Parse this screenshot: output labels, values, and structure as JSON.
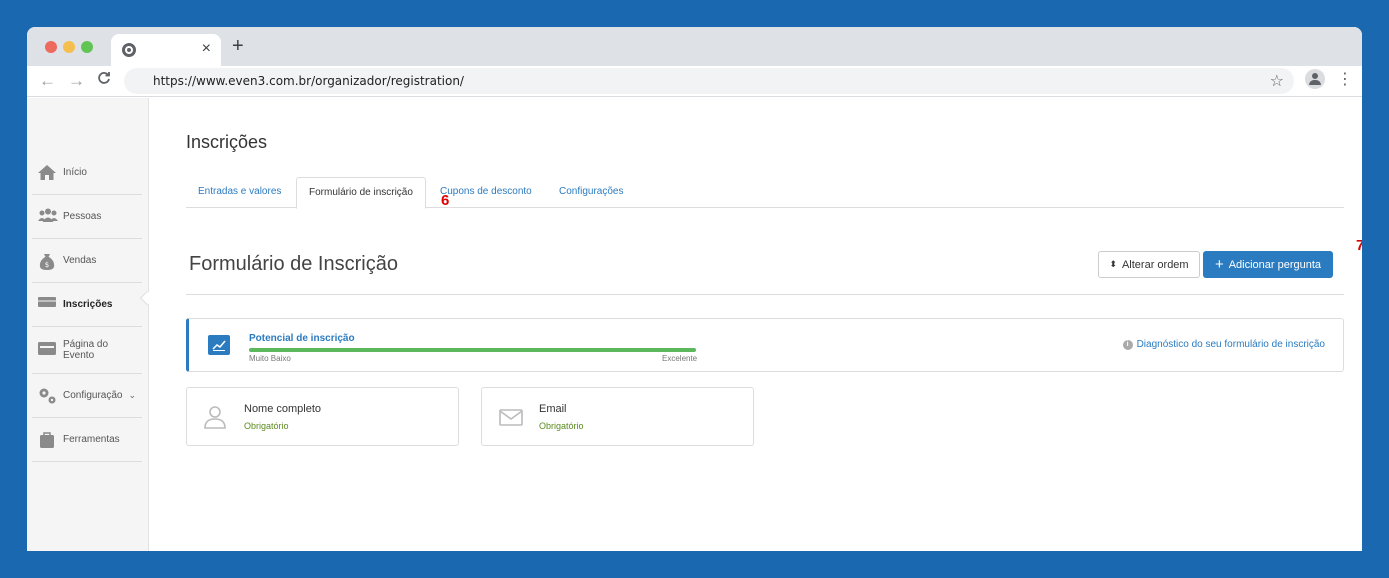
{
  "browser": {
    "tab_close": "×",
    "new_tab": "+",
    "url": "https://www.even3.com.br/organizador/registration/",
    "back": "←",
    "forward": "→",
    "reload": "C",
    "bookmark": "☆",
    "menu": "⋮"
  },
  "sidebar": {
    "items": [
      {
        "label": "Início",
        "icon": "home-icon"
      },
      {
        "label": "Pessoas",
        "icon": "people-icon"
      },
      {
        "label": "Vendas",
        "icon": "money-bag-icon"
      },
      {
        "label": "Inscrições",
        "icon": "ticket-icon",
        "active": true
      },
      {
        "label": "Página do Evento",
        "icon": "browser-window-icon"
      },
      {
        "label": "Configuração",
        "icon": "gears-icon",
        "chevron": "⌄"
      },
      {
        "label": "Ferramentas",
        "icon": "toolbox-icon"
      }
    ]
  },
  "main": {
    "title": "Inscrições",
    "tabs": [
      {
        "label": "Entradas e valores"
      },
      {
        "label": "Formulário de inscrição",
        "active": true
      },
      {
        "label": "Cupons de desconto"
      },
      {
        "label": "Configurações"
      }
    ],
    "section_title": "Formulário de Inscrição",
    "order_button": "Alterar ordem",
    "add_button": "Adicionar pergunta",
    "add_button_plus": "+",
    "order_icon": "⬍",
    "potential": {
      "title": "Potencial de inscrição",
      "low_label": "Muito Baixo",
      "high_label": "Excelente",
      "level": 1.0,
      "diagnostic_link": "Diagnóstico do seu formulário de inscrição",
      "info_glyph": "i"
    },
    "fields": [
      {
        "name": "Nome completo",
        "required": "Obrigatório",
        "icon": "user-icon"
      },
      {
        "name": "Email",
        "required": "Obrigatório",
        "icon": "envelope-icon"
      }
    ]
  },
  "annotations": {
    "marker_6": "6",
    "marker_7": "7"
  },
  "colors": {
    "background": "#1a68b0",
    "accent": "#2b7bc0",
    "success": "#5cb85c",
    "required": "#5b8a1f",
    "marker": "#e00000"
  }
}
